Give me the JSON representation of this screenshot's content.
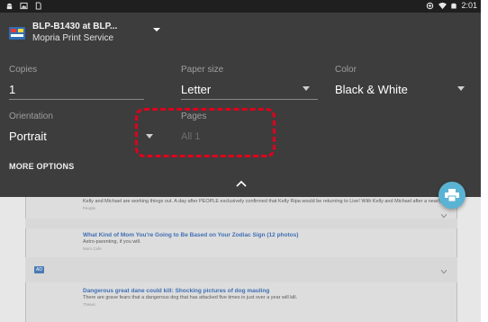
{
  "status_bar": {
    "time": "2:01",
    "left_icons": [
      "android-icon",
      "image-icon",
      "sim-card-icon"
    ],
    "right_icons": [
      "data-saver-icon",
      "wifi-icon",
      "battery-icon"
    ]
  },
  "printer": {
    "name": "BLP-B1430 at BLP...",
    "service": "Mopria Print Service"
  },
  "settings": {
    "copies": {
      "label": "Copies",
      "value": "1"
    },
    "paper_size": {
      "label": "Paper size",
      "value": "Letter"
    },
    "color": {
      "label": "Color",
      "value": "Black & White"
    },
    "orientation": {
      "label": "Orientation",
      "value": "Portrait"
    },
    "pages": {
      "label": "Pages",
      "value": "All 1"
    }
  },
  "more_options_label": "MORE OPTIONS",
  "colors": {
    "panel_bg": "#3d3d3d",
    "fab": "#5bb3d3",
    "highlight": "#e0001b",
    "link": "#3f6fb4"
  },
  "background_articles": [
    {
      "title": "",
      "body": "Kelly and Michael are working things out. A day after PEOPLE exclusively confirmed that Kelly Ripa would be returning to Live! With Kelly and Michael after a nearly weeklong absence, a source says Michael Strahan is excited to have her back.",
      "source": "People"
    },
    {
      "title": "What Kind of Mom You're Going to Be Based on Your Zodiac Sign (12 photos)",
      "body": "Astro-parenting, if you will.",
      "source": "Mom Cafe"
    },
    {
      "title": "Dangerous great dane could kill: Shocking pictures of dog mauling",
      "body": "There are grave fears that a dangerous dog that has attacked five times in just over a year will kill.",
      "source": "7News"
    }
  ],
  "badge_text": "AD"
}
